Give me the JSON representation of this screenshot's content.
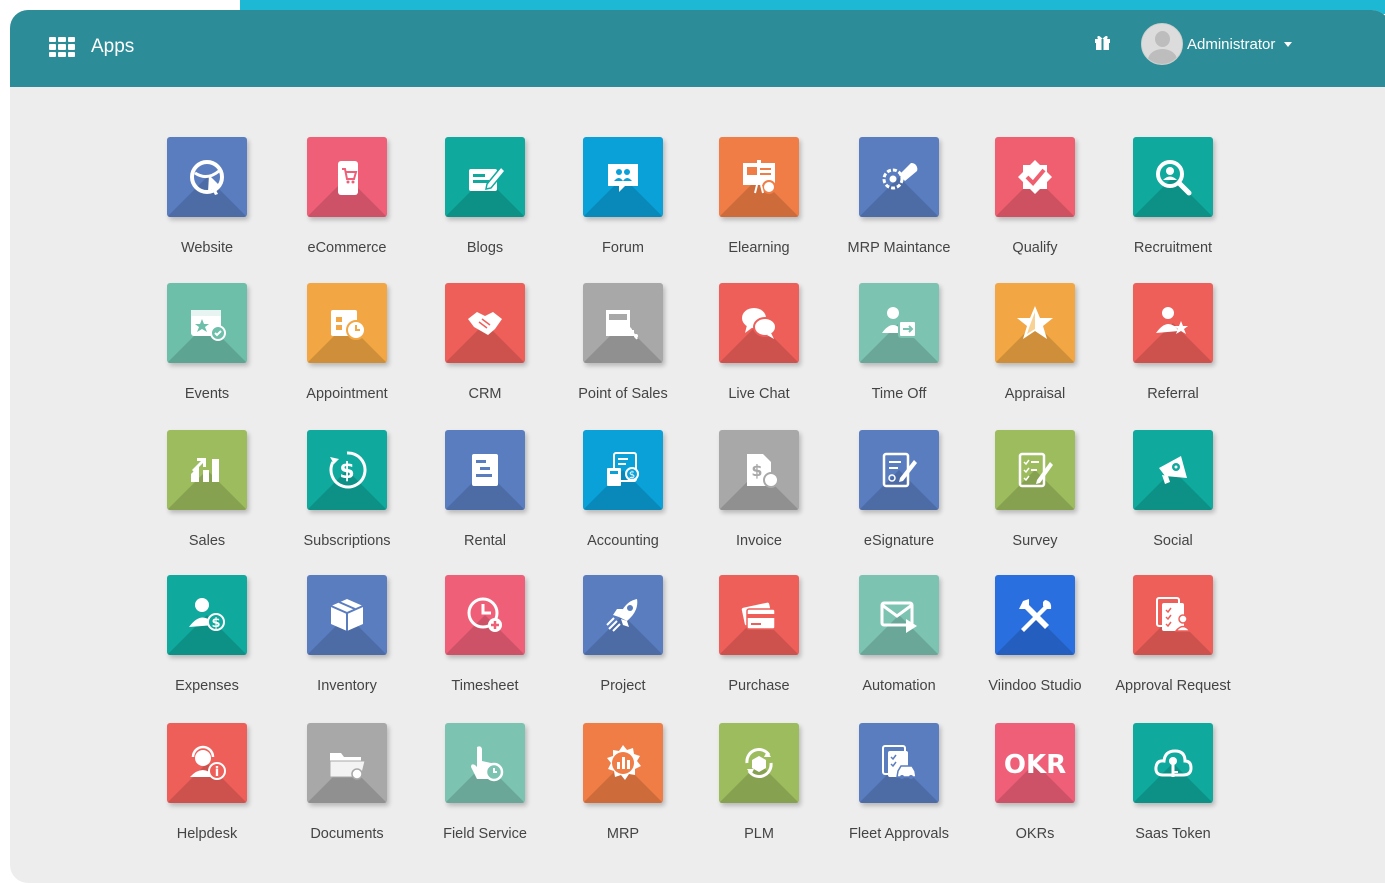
{
  "header": {
    "title": "Apps",
    "user_name": "Administrator"
  },
  "colors": {
    "navbar": "#2c8d98",
    "background": "#ededed"
  },
  "apps": [
    {
      "label": "Website",
      "color": "#5a7dc0",
      "icon": "globe-cursor-icon"
    },
    {
      "label": "eCommerce",
      "color": "#ef5f78",
      "icon": "mobile-cart-icon"
    },
    {
      "label": "Blogs",
      "color": "#10a99d",
      "icon": "edit-board-icon"
    },
    {
      "label": "Forum",
      "color": "#0aa0d8",
      "icon": "chat-users-icon"
    },
    {
      "label": "Elearning",
      "color": "#ef7d45",
      "icon": "presentation-icon"
    },
    {
      "label": "MRP Maintance",
      "color": "#5a7dc0",
      "icon": "gear-wrench-icon"
    },
    {
      "label": "Qualify",
      "color": "#ef5f70",
      "icon": "badge-check-icon"
    },
    {
      "label": "Recruitment",
      "color": "#10a99d",
      "icon": "search-person-icon"
    },
    {
      "label": "Events",
      "color": "#6dbfaa",
      "icon": "calendar-star-icon"
    },
    {
      "label": "Appointment",
      "color": "#f2a744",
      "icon": "calendar-clock-icon"
    },
    {
      "label": "CRM",
      "color": "#ef5f5a",
      "icon": "handshake-icon"
    },
    {
      "label": "Point of Sales",
      "color": "#a8a8a8",
      "icon": "register-icon"
    },
    {
      "label": "Live Chat",
      "color": "#ef5f5a",
      "icon": "chat-bubbles-icon"
    },
    {
      "label": "Time Off",
      "color": "#7cc3b1",
      "icon": "person-calendar-icon"
    },
    {
      "label": "Appraisal",
      "color": "#f2a744",
      "icon": "star-icon"
    },
    {
      "label": "Referral",
      "color": "#ef5f5a",
      "icon": "person-star-icon"
    },
    {
      "label": "Sales",
      "color": "#9cbc5e",
      "icon": "sales-chart-icon"
    },
    {
      "label": "Subscriptions",
      "color": "#10a99d",
      "icon": "dollar-refresh-icon"
    },
    {
      "label": "Rental",
      "color": "#5a7dc0",
      "icon": "document-list-icon"
    },
    {
      "label": "Accounting",
      "color": "#0aa0d8",
      "icon": "calculator-icon"
    },
    {
      "label": "Invoice",
      "color": "#a8a8a8",
      "icon": "invoice-icon"
    },
    {
      "label": "eSignature",
      "color": "#5a7dc0",
      "icon": "sign-pen-icon"
    },
    {
      "label": "Survey",
      "color": "#9cbc5e",
      "icon": "checklist-pen-icon"
    },
    {
      "label": "Social",
      "color": "#10a99d",
      "icon": "megaphone-icon"
    },
    {
      "label": "Expenses",
      "color": "#10a99d",
      "icon": "person-dollar-icon"
    },
    {
      "label": "Inventory",
      "color": "#5a7dc0",
      "icon": "box-icon"
    },
    {
      "label": "Timesheet",
      "color": "#ef5f78",
      "icon": "clock-plus-icon"
    },
    {
      "label": "Project",
      "color": "#5a7dc0",
      "icon": "rocket-icon"
    },
    {
      "label": "Purchase",
      "color": "#ef5f5a",
      "icon": "credit-card-icon"
    },
    {
      "label": "Automation",
      "color": "#7cc3b1",
      "icon": "mail-play-icon"
    },
    {
      "label": "Viindoo Studio",
      "color": "#2a6fe0",
      "icon": "tools-icon"
    },
    {
      "label": "Approval Request",
      "color": "#ef5f5a",
      "icon": "document-person-icon"
    },
    {
      "label": "Helpdesk",
      "color": "#ef5f5a",
      "icon": "headset-icon"
    },
    {
      "label": "Documents",
      "color": "#a8a8a8",
      "icon": "folder-icon"
    },
    {
      "label": "Field Service",
      "color": "#7cc3b1",
      "icon": "hand-clock-icon"
    },
    {
      "label": "MRP",
      "color": "#ef7d45",
      "icon": "gear-chart-icon"
    },
    {
      "label": "PLM",
      "color": "#9cbc5e",
      "icon": "cycle-box-icon"
    },
    {
      "label": "Fleet Approvals",
      "color": "#5a7dc0",
      "icon": "document-car-icon"
    },
    {
      "label": "OKRs",
      "color": "#ef5f78",
      "icon": "okr-icon",
      "icon_text": "OKR"
    },
    {
      "label": "Saas Token",
      "color": "#10a99d",
      "icon": "cloud-key-icon"
    }
  ]
}
